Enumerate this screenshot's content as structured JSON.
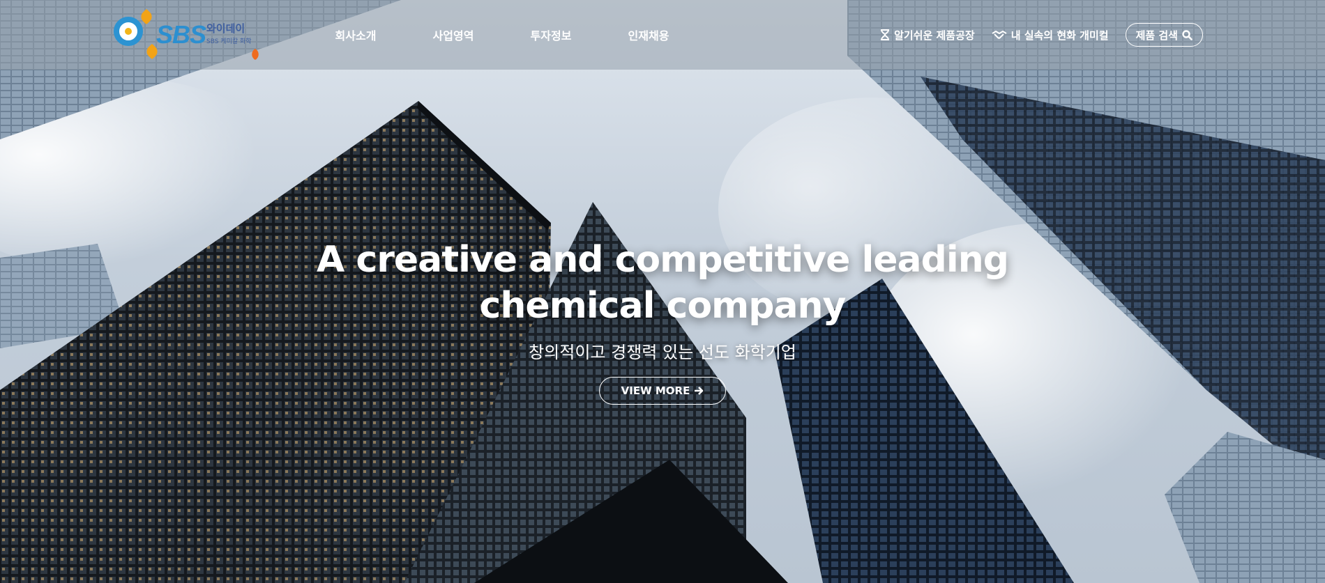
{
  "brand": {
    "logo_text": "SBS",
    "logo_kr": "와이데이",
    "logo_sub": "SBS 케미칼 화학"
  },
  "nav": {
    "items": [
      {
        "label": "회사소개"
      },
      {
        "label": "사업영역"
      },
      {
        "label": "투자정보"
      },
      {
        "label": "인재채용"
      }
    ]
  },
  "utility": {
    "factory_label": "알기쉬운 제품공장",
    "chemical_label": "내 실속의 현화 개미컬",
    "search_label": "제품 검색",
    "icons": [
      "hourglass-icon",
      "handshake-icon",
      "search-icon"
    ]
  },
  "hero": {
    "title_line1": "A creative and competitive leading",
    "title_line2": "chemical company",
    "subtitle": "창의적이고 경쟁력 있는 선도 화학기업",
    "button_label": "VIEW MORE",
    "button_icon": "arrow-right-icon"
  },
  "colors": {
    "brand_blue": "#2c93d2",
    "brand_orange": "#f2a316",
    "header_overlay": "rgba(150,160,172,0.55)"
  }
}
